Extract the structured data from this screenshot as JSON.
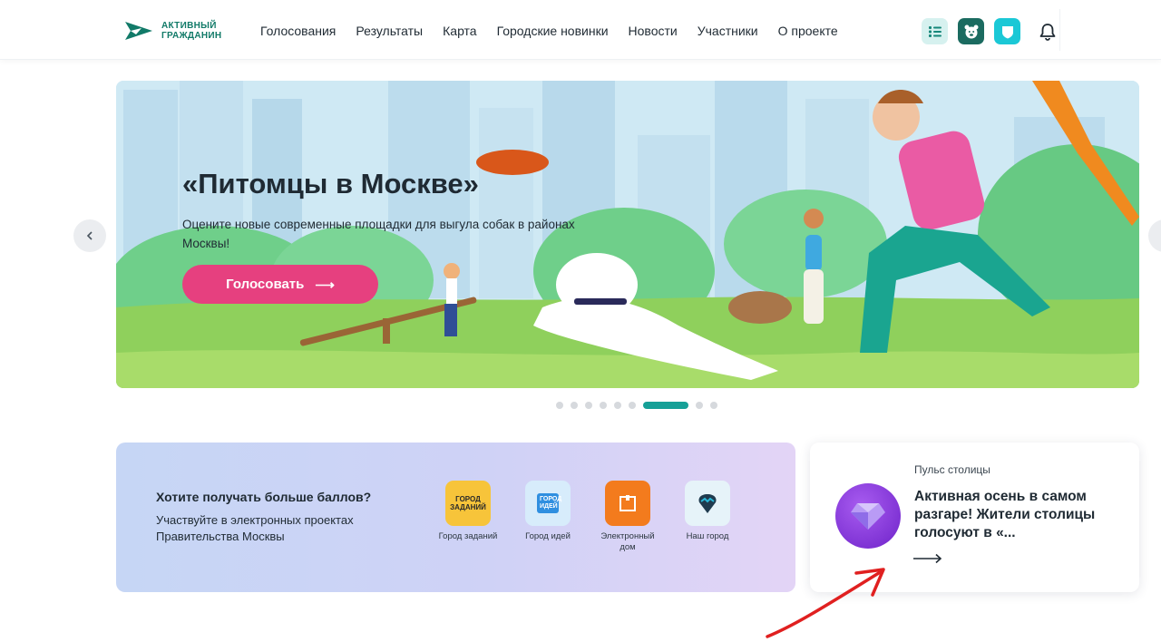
{
  "header": {
    "logo_line1": "АКТИВНЫЙ",
    "logo_line2": "ГРАЖДАНИН",
    "nav": [
      {
        "label": "Голосования"
      },
      {
        "label": "Результаты"
      },
      {
        "label": "Карта"
      },
      {
        "label": "Городские новинки"
      },
      {
        "label": "Новости"
      },
      {
        "label": "Участники"
      },
      {
        "label": "О проекте"
      }
    ],
    "icons": [
      "list-icon",
      "bear-icon",
      "shield-icon",
      "bell-icon"
    ]
  },
  "banner": {
    "title": "«Питомцы в Москве»",
    "subtitle": "Оцените новые современные площадки для выгула собак в районах Москвы!",
    "button_label": "Голосовать",
    "button_arrow": "⟶",
    "total_slides": 9,
    "active_slide": 7
  },
  "points": {
    "title": "Хотите получать больше баллов?",
    "text": "Участвуйте в электронных проектах Правительства Москвы",
    "apps": [
      {
        "label": "Город заданий",
        "tile_text": "ГОРОД ЗАДАНИЙ",
        "color": "#f7c43a"
      },
      {
        "label": "Город идей",
        "tile_text": "ГОРОД ИДЕЙ",
        "color": "#d7ecfb"
      },
      {
        "label": "Электронный дом",
        "tile_text": "",
        "color": "#f37b1d"
      },
      {
        "label": "Наш город",
        "tile_text": "",
        "color": "#e6f3f9"
      }
    ]
  },
  "pulse": {
    "kicker": "Пульс столицы",
    "title": "Активная осень в самом разгаре! Жители столицы голосуют в «...",
    "arrow": "⟶"
  },
  "colors": {
    "brand": "#117a68",
    "accent_pink": "#e6407f",
    "dot_active": "#16a097",
    "annotation_red": "#e02020"
  }
}
